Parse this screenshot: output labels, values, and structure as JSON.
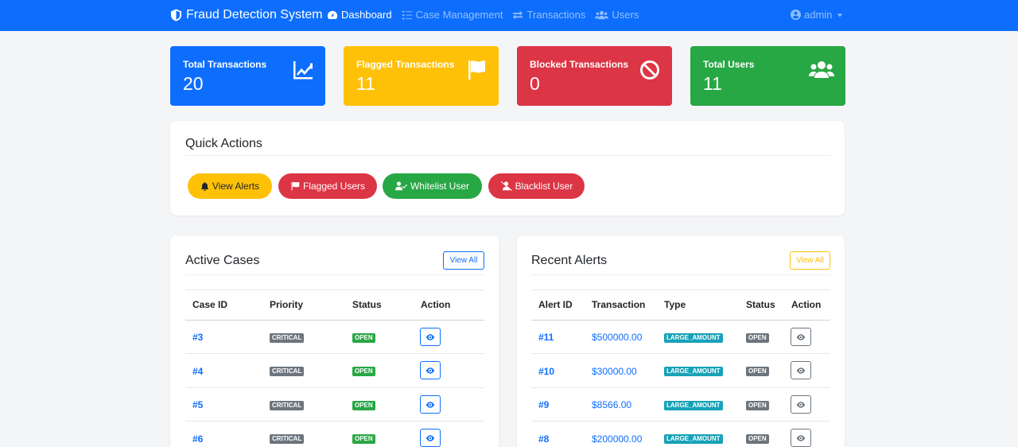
{
  "navbar": {
    "brand": "Fraud Detection System",
    "links": [
      {
        "label": "Dashboard",
        "active": true,
        "icon": "dashboard-icon"
      },
      {
        "label": "Case Management",
        "active": false,
        "icon": "tasks-icon"
      },
      {
        "label": "Transactions",
        "active": false,
        "icon": "exchange-icon"
      },
      {
        "label": "Users",
        "active": false,
        "icon": "users-icon"
      }
    ],
    "user": "admin",
    "color": "#0d6efd"
  },
  "stats": [
    {
      "label": "Total Transactions",
      "value": "20",
      "color": "#0d6efd",
      "icon": "chart-line-icon"
    },
    {
      "label": "Flagged Transactions",
      "value": "11",
      "color": "#ffc107",
      "icon": "flag-icon"
    },
    {
      "label": "Blocked Transactions",
      "value": "0",
      "color": "#dc3545",
      "icon": "ban-icon"
    },
    {
      "label": "Total Users",
      "value": "11",
      "color": "#28a745",
      "icon": "users-icon"
    }
  ],
  "quick_actions": {
    "title": "Quick Actions",
    "buttons": [
      {
        "label": "View Alerts",
        "color": "#ffc107",
        "icon": "bell-icon"
      },
      {
        "label": "Flagged Users",
        "color": "#dc3545",
        "icon": "flag-icon"
      },
      {
        "label": "Whitelist User",
        "color": "#28a745",
        "icon": "user-check-icon"
      },
      {
        "label": "Blacklist User",
        "color": "#dc3545",
        "icon": "user-slash-icon"
      }
    ]
  },
  "active_cases": {
    "title": "Active Cases",
    "view_all": "View All",
    "columns": [
      "Case ID",
      "Priority",
      "Status",
      "Action"
    ],
    "rows": [
      {
        "id": "#3",
        "priority": "CRITICAL",
        "status": "OPEN"
      },
      {
        "id": "#4",
        "priority": "CRITICAL",
        "status": "OPEN"
      },
      {
        "id": "#5",
        "priority": "CRITICAL",
        "status": "OPEN"
      },
      {
        "id": "#6",
        "priority": "CRITICAL",
        "status": "OPEN"
      }
    ]
  },
  "recent_alerts": {
    "title": "Recent Alerts",
    "view_all": "View All",
    "columns": [
      "Alert ID",
      "Transaction",
      "Type",
      "Status",
      "Action"
    ],
    "rows": [
      {
        "id": "#11",
        "transaction": "$500000.00",
        "type": "LARGE_AMOUNT",
        "status": "OPEN"
      },
      {
        "id": "#10",
        "transaction": "$30000.00",
        "type": "LARGE_AMOUNT",
        "status": "OPEN"
      },
      {
        "id": "#9",
        "transaction": "$8566.00",
        "type": "LARGE_AMOUNT",
        "status": "OPEN"
      },
      {
        "id": "#8",
        "transaction": "$200000.00",
        "type": "LARGE_AMOUNT",
        "status": "OPEN"
      }
    ]
  }
}
